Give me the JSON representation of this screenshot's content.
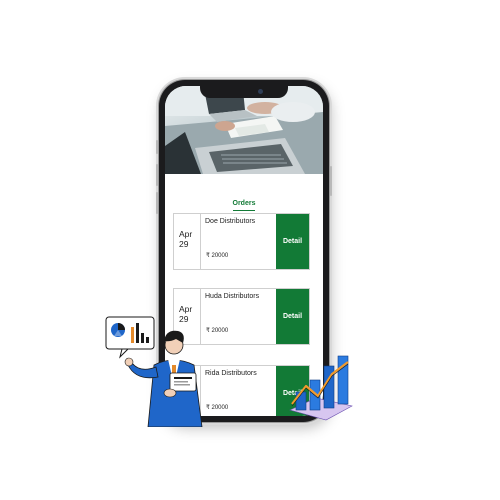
{
  "tabs": {
    "active": "Orders"
  },
  "orders": [
    {
      "month": "Apr",
      "day": "29",
      "name": "Doe Distributors",
      "amount": "₹ 20000",
      "action": "Detail"
    },
    {
      "month": "Apr",
      "day": "29",
      "name": "Huda Distributors",
      "amount": "₹ 20000",
      "action": "Detail"
    },
    {
      "month": "",
      "day": "",
      "name": "Rida Distributors",
      "amount": "₹ 20000",
      "action": "Detail"
    }
  ],
  "colors": {
    "accent": "#127a36",
    "phone_frame": "#1b1b1d"
  },
  "icons": [
    "office-photo",
    "analytics-person-illustration",
    "growth-chart-illustration"
  ]
}
